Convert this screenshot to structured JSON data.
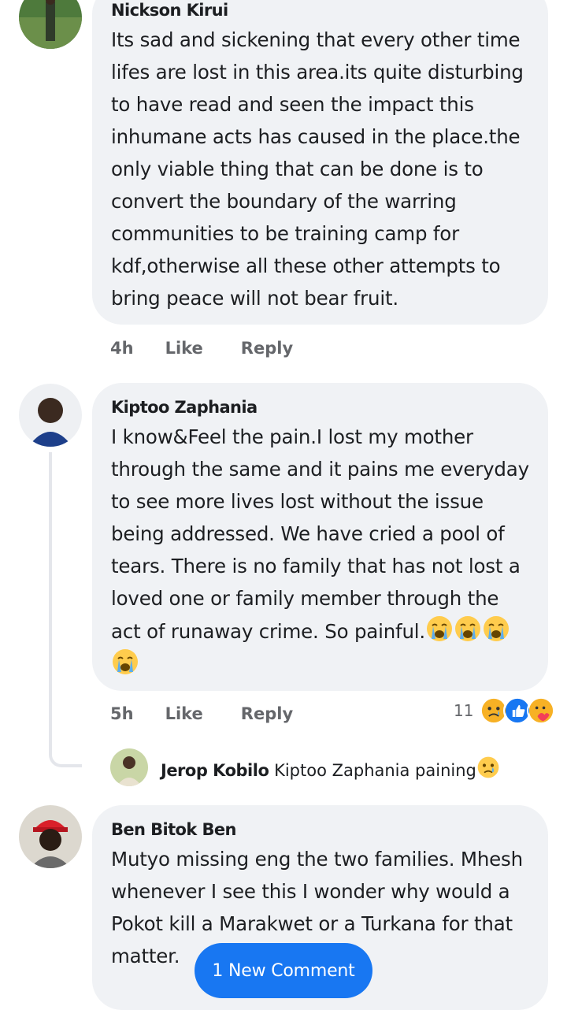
{
  "comments": [
    {
      "author": "Nickson Kirui",
      "text": "Its sad and sickening that every other time lifes are lost in this area.its quite disturbing to have read and seen the impact this inhumane acts has caused in the place.the only viable thing that can be done is to convert the boundary of the warring communities to be training camp for kdf,otherwise all these other attempts to bring peace will not bear fruit.",
      "time": "4h",
      "like_label": "Like",
      "reply_label": "Reply"
    },
    {
      "author": "Kiptoo Zaphania",
      "text": "I know&Feel the pain.I lost my mother through the same and it pains me everyday to see more lives lost without the issue being addressed. We have cried a pool of tears. There is no family that has not lost a loved one or family member through the act of runaway crime. So painful.",
      "time": "5h",
      "like_label": "Like",
      "reply_label": "Reply",
      "reaction_count": "11",
      "reaction_icons": [
        "sad-face-icon",
        "like-icon",
        "care-icon"
      ],
      "trailing_emoji": "loudly-crying-face-icon"
    },
    {
      "author": "Ben Bitok Ben",
      "text": "Mutyo missing eng the two families. Mhesh whenever I see this I wonder why would a Pokot kill a Marakwet or a Turkana for that matter."
    }
  ],
  "reply": {
    "author": "Jerop Kobilo",
    "text": "Kiptoo Zaphania paining",
    "emoji": "crying-face-icon"
  },
  "new_comment_button": "1 New Comment",
  "colors": {
    "bubble": "#f0f2f5",
    "meta": "#65676b",
    "accent": "#1877f2"
  }
}
